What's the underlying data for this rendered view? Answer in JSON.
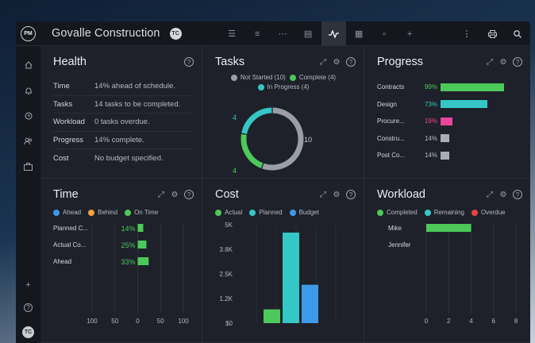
{
  "app": {
    "logo": "PM",
    "project_title": "Govalle Construction",
    "user_initials": "TC"
  },
  "toolbar": {
    "view_icons": [
      "list-icon",
      "gantt-icon",
      "board-icon",
      "sheet-icon",
      "dashboard-icon",
      "calendar-icon",
      "files-icon",
      "add-icon"
    ],
    "active_view": "dashboard-icon",
    "right_icons": [
      "more-icon",
      "print-icon",
      "search-icon"
    ]
  },
  "sidebar": {
    "items": [
      "home-icon",
      "notifications-icon",
      "time-icon",
      "team-icon",
      "portfolio-icon"
    ],
    "bottom": [
      "add-icon",
      "help-icon"
    ],
    "user_initials": "TC"
  },
  "health": {
    "title": "Health",
    "rows": [
      {
        "key": "Time",
        "value": "14% ahead of schedule."
      },
      {
        "key": "Tasks",
        "value": "14 tasks to be completed."
      },
      {
        "key": "Workload",
        "value": "0 tasks overdue."
      },
      {
        "key": "Progress",
        "value": "14% complete."
      },
      {
        "key": "Cost",
        "value": "No budget specified."
      }
    ]
  },
  "tasks": {
    "title": "Tasks",
    "legend": [
      {
        "label": "Not Started (10)",
        "color": "#9a9ea8"
      },
      {
        "label": "Complete (4)",
        "color": "#4cc95a"
      },
      {
        "label": "In Progress (4)",
        "color": "#35c6c6"
      }
    ]
  },
  "progress": {
    "title": "Progress",
    "rows": [
      {
        "name": "Contracts",
        "pct": "99%",
        "value": 99,
        "color": "#4cc95a",
        "pct_color": "#4cc95a"
      },
      {
        "name": "Design",
        "pct": "73%",
        "value": 73,
        "color": "#35c6c6",
        "pct_color": "#35c6c6"
      },
      {
        "name": "Procure...",
        "pct": "19%",
        "value": 19,
        "color": "#e8469a",
        "pct_color": "#e8469a"
      },
      {
        "name": "Constru...",
        "pct": "14%",
        "value": 14,
        "color": "#a9adb6",
        "pct_color": "#b5b9c3"
      },
      {
        "name": "Post Co...",
        "pct": "14%",
        "value": 14,
        "color": "#a9adb6",
        "pct_color": "#b5b9c3"
      }
    ]
  },
  "time": {
    "title": "Time",
    "legend": [
      {
        "label": "Ahead",
        "color": "#3d9ae8"
      },
      {
        "label": "Behind",
        "color": "#f0a040"
      },
      {
        "label": "On Time",
        "color": "#4cc95a"
      }
    ]
  },
  "cost": {
    "title": "Cost",
    "legend": [
      {
        "label": "Actual",
        "color": "#4cc95a"
      },
      {
        "label": "Planned",
        "color": "#35c6c6"
      },
      {
        "label": "Budget",
        "color": "#3d9ae8"
      }
    ]
  },
  "workload": {
    "title": "Workload",
    "legend": [
      {
        "label": "Completed",
        "color": "#4cc95a"
      },
      {
        "label": "Remaining",
        "color": "#35c6c6"
      },
      {
        "label": "Overdue",
        "color": "#e84545"
      }
    ]
  },
  "chart_data": [
    {
      "chart": "tasks-donut",
      "type": "pie",
      "categories": [
        "Not Started",
        "Complete",
        "In Progress"
      ],
      "values": [
        10,
        4,
        4
      ],
      "colors": [
        "#9a9ea8",
        "#4cc95a",
        "#35c6c6"
      ],
      "data_labels": [
        "10",
        "4",
        "4"
      ]
    },
    {
      "chart": "time-bars",
      "type": "bar",
      "orientation": "horizontal",
      "categories": [
        "Planned C...",
        "Actual Co...",
        "Ahead"
      ],
      "values": [
        14,
        25,
        33
      ],
      "labels": [
        "14%",
        "25%",
        "33%"
      ],
      "color": "#4cc95a",
      "xlim": [
        -100,
        100
      ],
      "xticks": [
        "100",
        "50",
        "0",
        "50",
        "100"
      ]
    },
    {
      "chart": "cost-bars",
      "type": "bar",
      "categories": [
        "Actual",
        "Planned",
        "Budget"
      ],
      "values": [
        700,
        4600,
        1950
      ],
      "colors": [
        "#4cc95a",
        "#35c6c6",
        "#3d9ae8"
      ],
      "ylim": [
        0,
        5000
      ],
      "yticks": [
        "$0",
        "1.2K",
        "2.5K",
        "3.8K",
        "5K"
      ]
    },
    {
      "chart": "workload-bars",
      "type": "bar",
      "orientation": "horizontal",
      "categories": [
        "Mike",
        "Jennifer"
      ],
      "series": [
        {
          "name": "Completed",
          "values": [
            4,
            0
          ],
          "color": "#4cc95a"
        }
      ],
      "xlim": [
        0,
        8
      ],
      "xticks": [
        "0",
        "2",
        "4",
        "6",
        "8"
      ]
    }
  ]
}
